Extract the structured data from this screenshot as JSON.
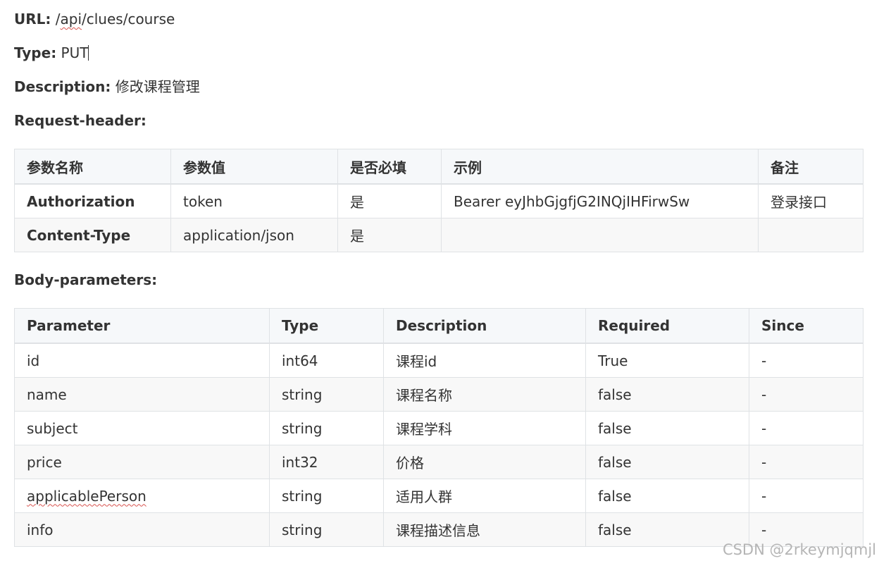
{
  "api": {
    "url_label": "URL:",
    "url_prefix": "/",
    "url_squiggle": "api",
    "url_rest": "/clues/course",
    "type_label": "Type:",
    "type_value": "PUT",
    "desc_label": "Description:",
    "desc_value": "修改课程管理",
    "header_section": "Request-header:",
    "body_section": "Body-parameters:"
  },
  "header_table": {
    "columns": [
      "参数名称",
      "参数值",
      "是否必填",
      "示例",
      "备注"
    ],
    "rows": [
      [
        "Authorization",
        "token",
        "是",
        "Bearer eyJhbGjgfjG2INQjIHFirwSw",
        "登录接口"
      ],
      [
        "Content-Type",
        "application/json",
        "是",
        "",
        ""
      ]
    ]
  },
  "body_table": {
    "columns": [
      "Parameter",
      "Type",
      "Description",
      "Required",
      "Since"
    ],
    "rows": [
      [
        "id",
        "int64",
        "课程id",
        "True",
        "-"
      ],
      [
        "name",
        "string",
        "课程名称",
        "false",
        "-"
      ],
      [
        "subject",
        "string",
        "课程学科",
        "false",
        "-"
      ],
      [
        "price",
        "int32",
        "价格",
        "false",
        "-"
      ],
      [
        "applicablePerson",
        "string",
        "适用人群",
        "false",
        "-"
      ],
      [
        "info",
        "string",
        "课程描述信息",
        "false",
        "-"
      ]
    ]
  },
  "watermark": "CSDN @2rkeymjqmjl"
}
